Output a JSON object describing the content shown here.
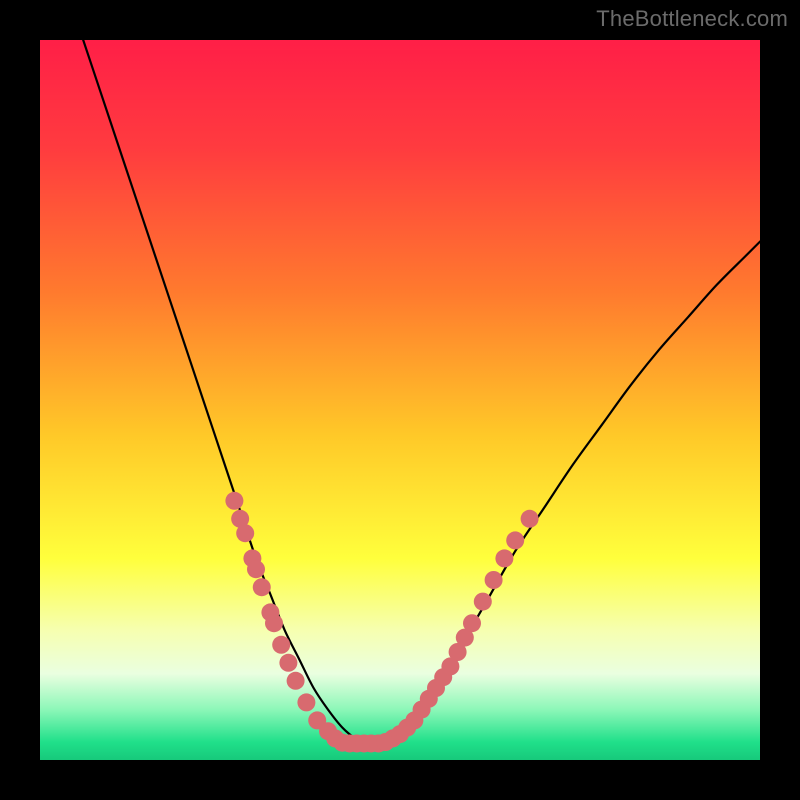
{
  "watermark": "TheBottleneck.com",
  "chart_data": {
    "type": "line",
    "title": "",
    "xlabel": "",
    "ylabel": "",
    "xlim": [
      0,
      100
    ],
    "ylim": [
      0,
      100
    ],
    "gradient_stops": [
      {
        "offset": 0.0,
        "color": "#ff1f47"
      },
      {
        "offset": 0.15,
        "color": "#ff3b3f"
      },
      {
        "offset": 0.35,
        "color": "#ff7a2e"
      },
      {
        "offset": 0.55,
        "color": "#ffc928"
      },
      {
        "offset": 0.72,
        "color": "#ffff3c"
      },
      {
        "offset": 0.82,
        "color": "#f6ffb0"
      },
      {
        "offset": 0.88,
        "color": "#eaffe0"
      },
      {
        "offset": 0.93,
        "color": "#8cf7b8"
      },
      {
        "offset": 0.975,
        "color": "#20e08a"
      },
      {
        "offset": 1.0,
        "color": "#17c97b"
      }
    ],
    "series": [
      {
        "name": "bottleneck-curve",
        "x": [
          6,
          8,
          10,
          12,
          14,
          16,
          18,
          20,
          22,
          24,
          26,
          28,
          30,
          32,
          34,
          36,
          38,
          40,
          42,
          44,
          45,
          46,
          48,
          50,
          52,
          54,
          56,
          58,
          62,
          66,
          70,
          74,
          78,
          82,
          86,
          90,
          94,
          98,
          100
        ],
        "y": [
          100,
          94,
          88,
          82,
          76,
          70,
          64,
          58,
          52,
          46,
          40,
          34,
          28,
          23,
          18,
          14,
          10,
          7,
          4.5,
          2.8,
          2.3,
          2.3,
          2.3,
          2.8,
          4.5,
          7.5,
          11,
          15,
          22,
          29,
          35,
          41,
          46.5,
          52,
          57,
          61.5,
          66,
          70,
          72
        ],
        "flat_bottom": {
          "x_start": 41,
          "x_end": 48,
          "y": 2.3
        }
      }
    ],
    "scatter_points": {
      "name": "highlight-dots",
      "color": "#d86a6f",
      "radius": 9,
      "points": [
        {
          "x": 27.0,
          "y": 36.0
        },
        {
          "x": 27.8,
          "y": 33.5
        },
        {
          "x": 28.5,
          "y": 31.5
        },
        {
          "x": 29.5,
          "y": 28.0
        },
        {
          "x": 30.0,
          "y": 26.5
        },
        {
          "x": 30.8,
          "y": 24.0
        },
        {
          "x": 32.0,
          "y": 20.5
        },
        {
          "x": 32.5,
          "y": 19.0
        },
        {
          "x": 33.5,
          "y": 16.0
        },
        {
          "x": 34.5,
          "y": 13.5
        },
        {
          "x": 35.5,
          "y": 11.0
        },
        {
          "x": 37.0,
          "y": 8.0
        },
        {
          "x": 38.5,
          "y": 5.5
        },
        {
          "x": 40.0,
          "y": 4.0
        },
        {
          "x": 41.0,
          "y": 3.0
        },
        {
          "x": 42.0,
          "y": 2.4
        },
        {
          "x": 43.0,
          "y": 2.3
        },
        {
          "x": 44.0,
          "y": 2.3
        },
        {
          "x": 45.0,
          "y": 2.3
        },
        {
          "x": 46.0,
          "y": 2.3
        },
        {
          "x": 47.0,
          "y": 2.3
        },
        {
          "x": 48.0,
          "y": 2.5
        },
        {
          "x": 49.0,
          "y": 3.0
        },
        {
          "x": 50.0,
          "y": 3.6
        },
        {
          "x": 51.0,
          "y": 4.5
        },
        {
          "x": 52.0,
          "y": 5.5
        },
        {
          "x": 53.0,
          "y": 7.0
        },
        {
          "x": 54.0,
          "y": 8.5
        },
        {
          "x": 55.0,
          "y": 10.0
        },
        {
          "x": 56.0,
          "y": 11.5
        },
        {
          "x": 57.0,
          "y": 13.0
        },
        {
          "x": 58.0,
          "y": 15.0
        },
        {
          "x": 59.0,
          "y": 17.0
        },
        {
          "x": 60.0,
          "y": 19.0
        },
        {
          "x": 61.5,
          "y": 22.0
        },
        {
          "x": 63.0,
          "y": 25.0
        },
        {
          "x": 64.5,
          "y": 28.0
        },
        {
          "x": 66.0,
          "y": 30.5
        },
        {
          "x": 68.0,
          "y": 33.5
        }
      ]
    }
  }
}
